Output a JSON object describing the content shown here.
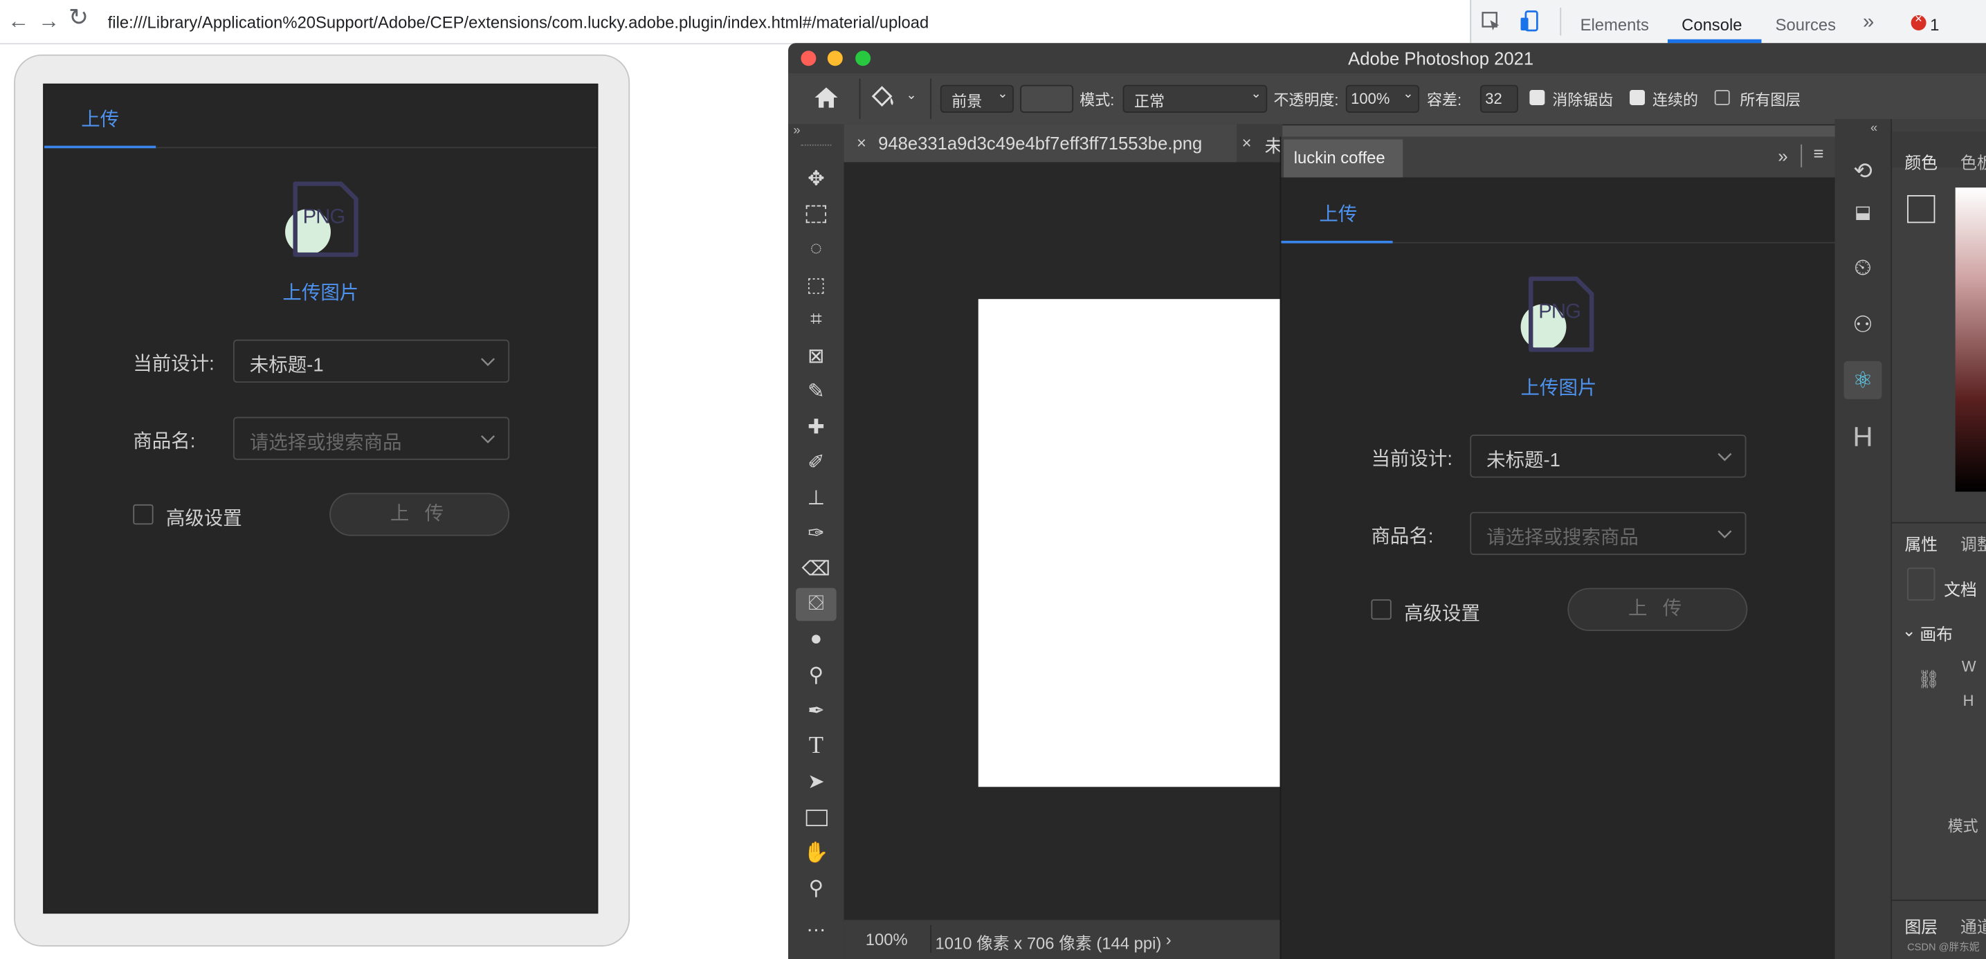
{
  "browser": {
    "url": "file:///Library/Application%20Support/Adobe/CEP/extensions/com.lucky.adobe.plugin/index.html#/material/upload",
    "back_icon": "back-arrow-icon",
    "forward_icon": "forward-arrow-icon",
    "reload_icon": "reload-icon"
  },
  "devtools": {
    "tabs": [
      "Elements",
      "Console",
      "Sources"
    ],
    "active_tab": "Console",
    "more": "»",
    "error_count": "1"
  },
  "plugin": {
    "tab_label": "上传",
    "upload_badge": "PNG",
    "upload_label": "上传图片",
    "design_label": "当前设计:",
    "design_value": "未标题-1",
    "product_label": "商品名:",
    "product_placeholder": "请选择或搜索商品",
    "advanced_label": "高级设置",
    "upload_button": "上 传"
  },
  "photoshop": {
    "title": "Adobe Photoshop 2021",
    "options": {
      "fill_source": "前景",
      "mode_label": "模式:",
      "mode_value": "正常",
      "opacity_label": "不透明度:",
      "opacity_value": "100%",
      "tolerance_label": "容差:",
      "tolerance_value": "32",
      "antialias_label": "消除锯齿",
      "antialias_checked": true,
      "contiguous_label": "连续的",
      "contiguous_checked": true,
      "all_layers_label": "所有图层",
      "all_layers_checked": false
    },
    "doc_tabs": [
      "948e331a9d3c49e4bf7eff3ff71553be.png",
      "未"
    ],
    "status": {
      "zoom": "100%",
      "info": "1010 像素 x 706 像素 (144 ppi)"
    },
    "panel_title": "luckin coffee",
    "right_panel": {
      "color_tabs": [
        "颜色",
        "色板"
      ],
      "props_tabs": [
        "属性",
        "调整"
      ],
      "doc_label": "文档",
      "canvas_label": "画布",
      "w_label": "W",
      "h_label": "H",
      "mode_label": "模式",
      "layers_tabs": [
        "图层",
        "通道"
      ]
    },
    "watermark": "CSDN @胖东妮"
  }
}
